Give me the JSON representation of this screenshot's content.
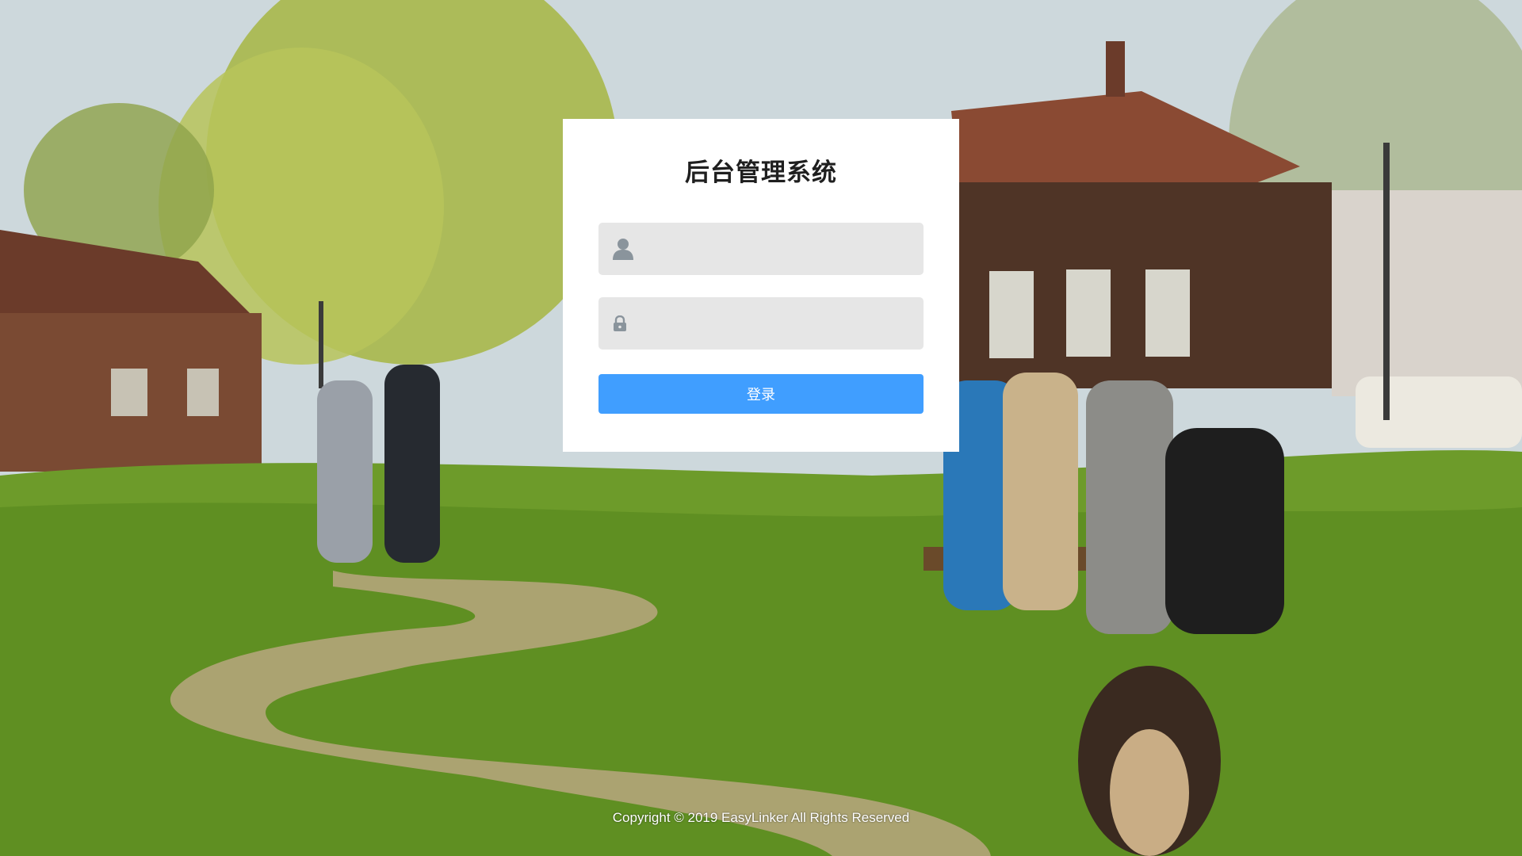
{
  "login": {
    "title": "后台管理系统",
    "username": {
      "value": "",
      "placeholder": "",
      "icon": "user-icon"
    },
    "password": {
      "value": "",
      "placeholder": "",
      "icon": "lock-icon"
    },
    "submit_label": "登录"
  },
  "footer": {
    "copyright": "Copyright © 2019 EasyLinker All Rights Reserved"
  },
  "colors": {
    "primary_button": "#409eff",
    "input_background": "#e6e6e6",
    "card_background": "#ffffff",
    "icon_color": "#8a949c"
  }
}
